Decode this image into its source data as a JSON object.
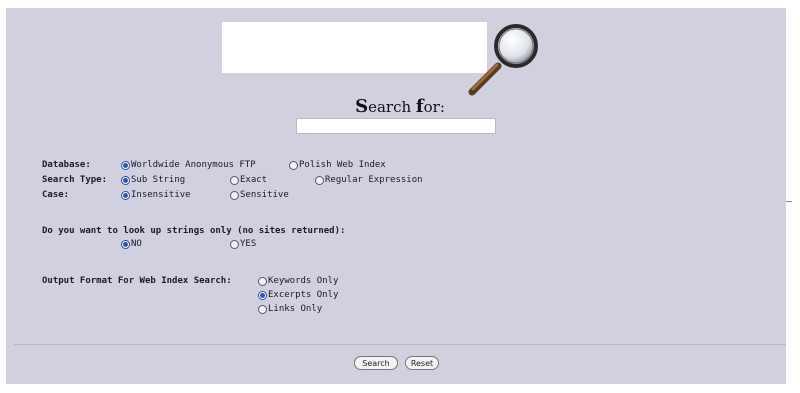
{
  "search": {
    "heading_first": "S",
    "heading_rest": "earch ",
    "heading_first2": "f",
    "heading_rest2": "or:",
    "value": ""
  },
  "form": {
    "database_label": "Database:",
    "database_options": [
      {
        "label": "Worldwide Anonymous FTP",
        "selected": true
      },
      {
        "label": "Polish Web Index",
        "selected": false
      }
    ],
    "search_type_label": "Search Type:",
    "search_type_options": [
      {
        "label": "Sub String",
        "selected": true
      },
      {
        "label": "Exact",
        "selected": false
      },
      {
        "label": "Regular Expression",
        "selected": false
      }
    ],
    "case_label": "Case:",
    "case_options": [
      {
        "label": "Insensitive",
        "selected": true
      },
      {
        "label": "Sensitive",
        "selected": false
      }
    ],
    "strings_question": "Do you want to look up strings only (no sites returned):",
    "strings_options": [
      {
        "label": "NO",
        "selected": true
      },
      {
        "label": "YES",
        "selected": false
      }
    ],
    "output_label": "Output Format For Web Index Search:",
    "output_options": [
      {
        "label": "Keywords Only",
        "selected": false
      },
      {
        "label": "Excerpts Only",
        "selected": true
      },
      {
        "label": "Links Only",
        "selected": false
      }
    ]
  },
  "buttons": {
    "search": "Search",
    "reset": "Reset"
  },
  "colors": {
    "page_background": "#d0d0df",
    "radio_selected": "#2a56b8"
  },
  "icons": {
    "logo": "magnifying-glass-icon"
  }
}
